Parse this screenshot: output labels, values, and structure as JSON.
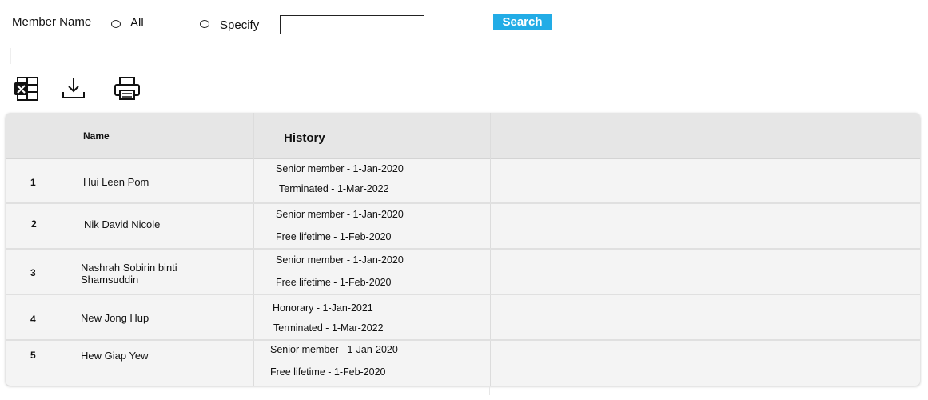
{
  "filter": {
    "member_name_label": "Member Name",
    "radio_all_label": "All",
    "radio_specify_label": "Specify",
    "specify_value": "",
    "search_label": "Search",
    "search_color": "#22ace6"
  },
  "toolbar": {
    "excel_icon": "excel-export-icon",
    "download_icon": "download-icon",
    "print_icon": "print-icon"
  },
  "table": {
    "headers": {
      "index": "",
      "name": "Name",
      "history": "History"
    },
    "rows": [
      {
        "num": "1",
        "name": "Hui Leen Pom",
        "history": [
          "Senior member - 1-Jan-2020",
          "Terminated - 1-Mar-2022"
        ]
      },
      {
        "num": "2",
        "name": "Nik David Nicole",
        "history": [
          "Senior member - 1-Jan-2020",
          "Free lifetime - 1-Feb-2020"
        ]
      },
      {
        "num": "3",
        "name": "Nashrah Sobirin binti Shamsuddin",
        "history": [
          "Senior member - 1-Jan-2020",
          "Free lifetime - 1-Feb-2020"
        ]
      },
      {
        "num": "4",
        "name": "New Jong Hup",
        "history": [
          "Honorary - 1-Jan-2021",
          "Terminated - 1-Mar-2022"
        ]
      },
      {
        "num": "5",
        "name": "Hew Giap Yew",
        "history": [
          "Senior member - 1-Jan-2020",
          "Free lifetime - 1-Feb-2020"
        ]
      }
    ]
  }
}
